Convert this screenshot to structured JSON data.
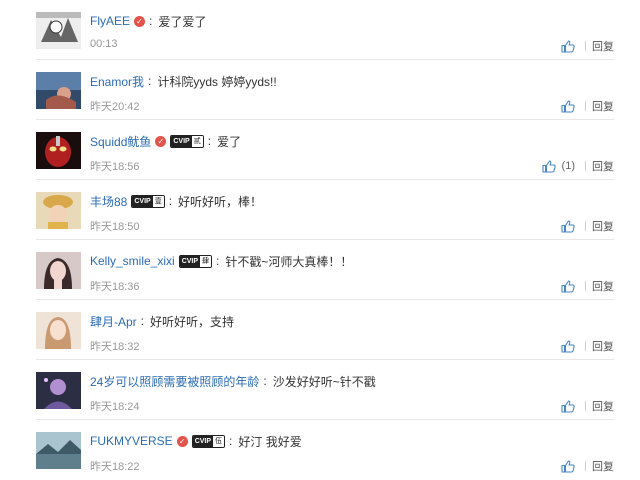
{
  "reply_label": "回复",
  "comments": [
    {
      "user": "FlyAEE",
      "verified": true,
      "vip": null,
      "text": "爱了爱了",
      "time": "00:13",
      "likes": null
    },
    {
      "user": "Enamor我",
      "verified": false,
      "vip": null,
      "text": "计科院yyds 婷婷yyds!!",
      "time": "昨天20:42",
      "likes": null
    },
    {
      "user": "Squidd鱿鱼",
      "verified": true,
      "vip": {
        "left": "CVIP",
        "right": "贰"
      },
      "text": "爱了",
      "time": "昨天18:56",
      "likes": "(1)"
    },
    {
      "user": "丰场88",
      "verified": false,
      "vip": {
        "left": "CVIP",
        "right": "壹"
      },
      "text": "好听好听，棒！",
      "time": "昨天18:50",
      "likes": null
    },
    {
      "user": "Kelly_smile_xixi",
      "verified": false,
      "vip": {
        "left": "CVIP",
        "right": "肆"
      },
      "text": "针不戳~河师大真棒！！",
      "time": "昨天18:36",
      "likes": null
    },
    {
      "user": "肆月-Apr",
      "verified": false,
      "vip": null,
      "text": "好听好听，支持",
      "time": "昨天18:32",
      "likes": null
    },
    {
      "user": "24岁可以照顾需要被照顾的年龄",
      "verified": false,
      "vip": null,
      "text": "沙发好好听~针不戳",
      "time": "昨天18:24",
      "likes": null
    },
    {
      "user": "FUKMYVERSE",
      "verified": true,
      "vip": {
        "left": "CVIP",
        "right": "伍"
      },
      "text": "好汀 我好爱",
      "time": "昨天18:22",
      "likes": null
    }
  ],
  "colors": {
    "username": "#2b6bb3",
    "like_icon": "#4a86c5",
    "verified": "#e3534b"
  }
}
